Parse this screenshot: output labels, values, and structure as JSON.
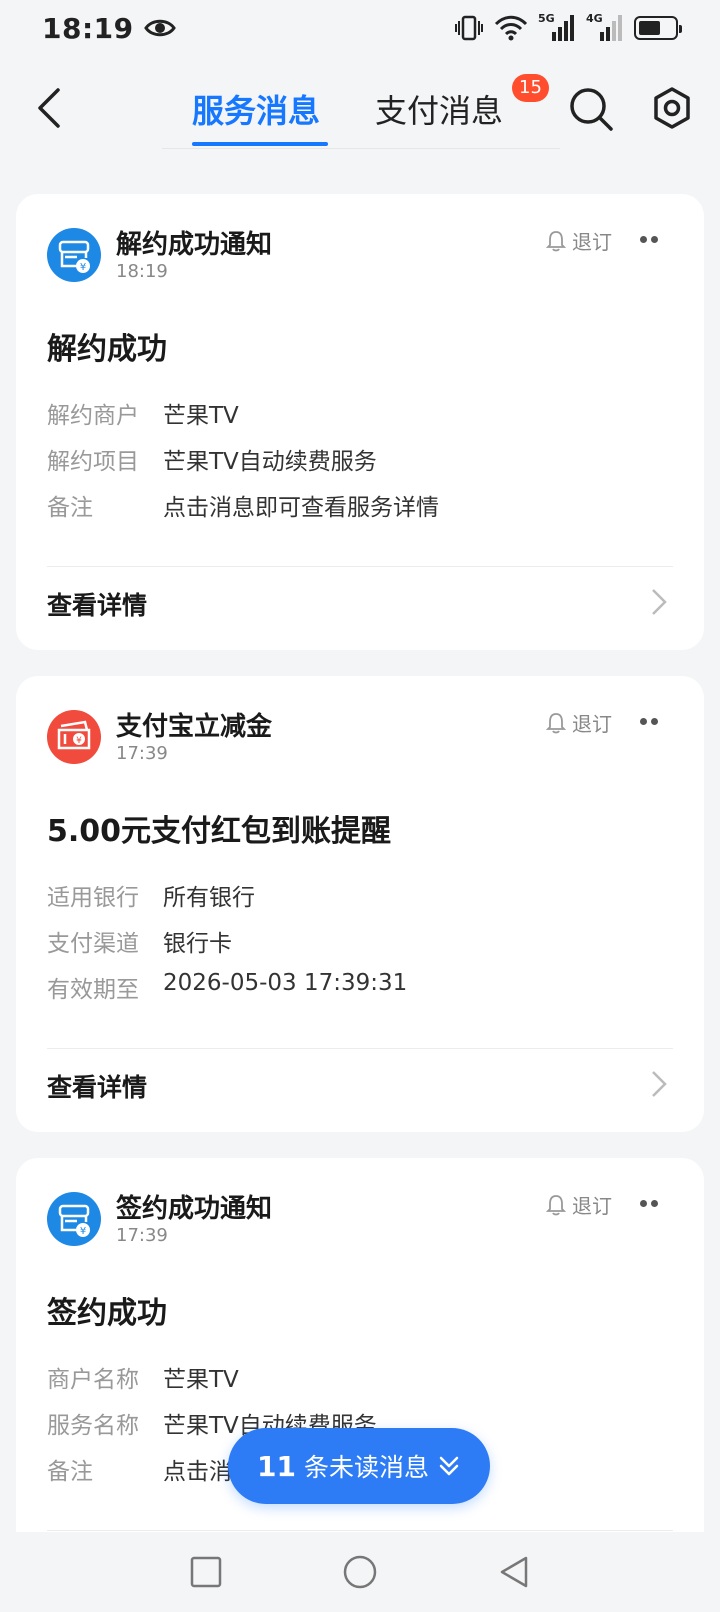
{
  "status_bar": {
    "time": "18:19",
    "network1": "5G",
    "network2": "4G"
  },
  "header": {
    "tabs": [
      {
        "label": "服务消息",
        "active": true
      },
      {
        "label": "支付消息",
        "active": false
      }
    ],
    "badge_count": "15",
    "icons": [
      "back-arrow-icon",
      "search-icon",
      "settings-icon"
    ]
  },
  "cards": [
    {
      "icon": "contract-icon",
      "icon_color": "#1e88e5",
      "title": "解约成功通知",
      "time": "18:19",
      "unsubscribe_label": "退订",
      "headline": "解约成功",
      "fields": [
        {
          "label": "解约商户",
          "value": "芒果TV"
        },
        {
          "label": "解约项目",
          "value": "芒果TV自动续费服务"
        },
        {
          "label": "备注",
          "value": "点击消息即可查看服务详情"
        }
      ],
      "detail_label": "查看详情"
    },
    {
      "icon": "red-envelope-icon",
      "icon_color": "#f04b3c",
      "title": "支付宝立减金",
      "time": "17:39",
      "unsubscribe_label": "退订",
      "headline": "5.00元支付红包到账提醒",
      "fields": [
        {
          "label": "适用银行",
          "value": "所有银行"
        },
        {
          "label": "支付渠道",
          "value": "银行卡"
        },
        {
          "label": "有效期至",
          "value": "2026-05-03 17:39:31"
        }
      ],
      "detail_label": "查看详情"
    },
    {
      "icon": "contract-icon",
      "icon_color": "#1e88e5",
      "title": "签约成功通知",
      "time": "17:39",
      "unsubscribe_label": "退订",
      "headline": "签约成功",
      "fields": [
        {
          "label": "商户名称",
          "value": "芒果TV"
        },
        {
          "label": "服务名称",
          "value": "芒果TV自动续费服务"
        },
        {
          "label": "备注",
          "value": "点击消息即可查看服务详情"
        }
      ]
    }
  ],
  "unread": {
    "count": "11",
    "label": "条未读消息"
  },
  "colors": {
    "accent": "#1677ff",
    "badge": "#ff4d2e",
    "background": "#f4f5f7"
  }
}
